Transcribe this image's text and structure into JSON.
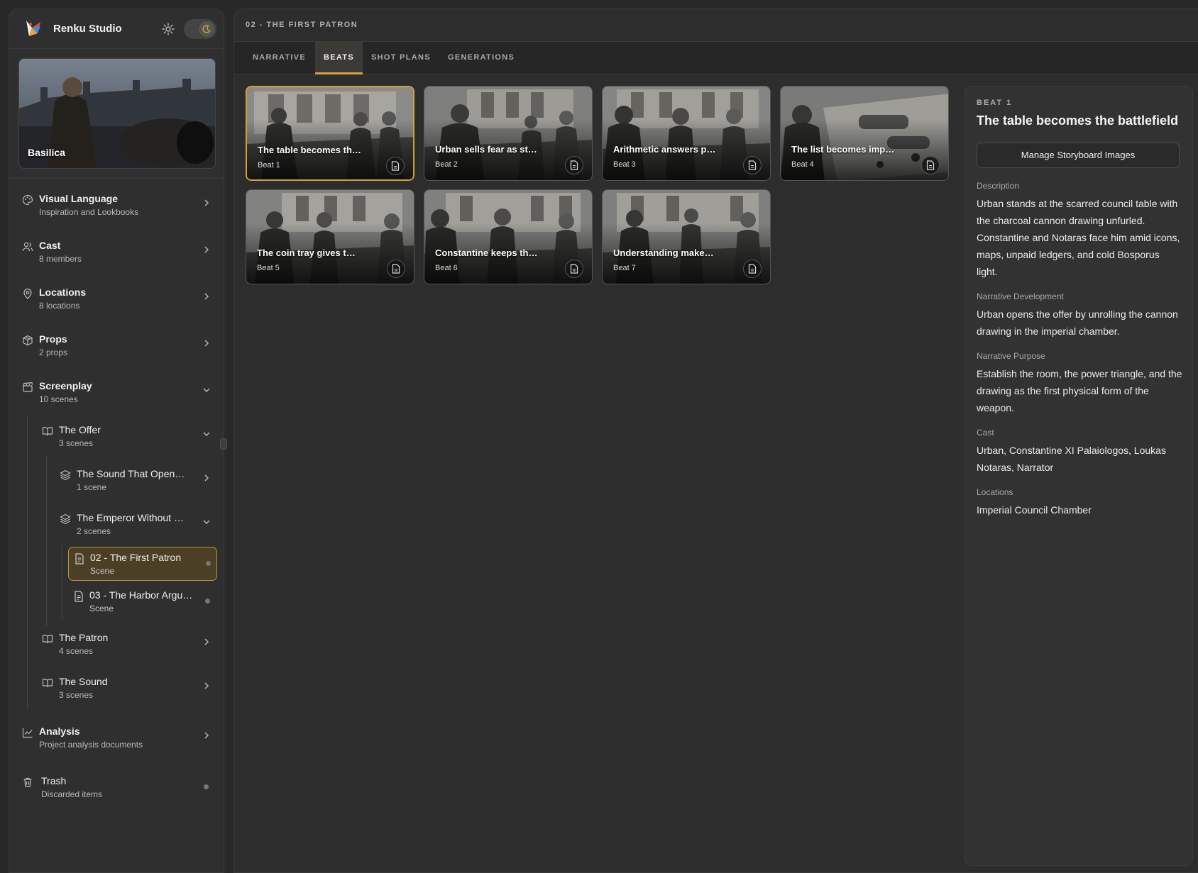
{
  "app": {
    "name": "Renku Studio"
  },
  "project": {
    "name": "Basilica"
  },
  "sidebar": {
    "items": [
      {
        "title": "Visual Language",
        "sub": "Inspiration and Lookbooks"
      },
      {
        "title": "Cast",
        "sub": "8 members"
      },
      {
        "title": "Locations",
        "sub": "8 locations"
      },
      {
        "title": "Props",
        "sub": "2 props"
      },
      {
        "title": "Screenplay",
        "sub": "10 scenes"
      },
      {
        "title": "Analysis",
        "sub": "Project analysis documents"
      },
      {
        "title": "Trash",
        "sub": "Discarded items"
      }
    ],
    "acts": [
      {
        "title": "The Offer",
        "sub": "3 scenes"
      },
      {
        "title": "The Patron",
        "sub": "4 scenes"
      },
      {
        "title": "The Sound",
        "sub": "3 scenes"
      }
    ],
    "sequences": [
      {
        "title": "The Sound That Open…",
        "sub": "1 scene"
      },
      {
        "title": "The Emperor Without …",
        "sub": "2 scenes"
      }
    ],
    "scenes": [
      {
        "title": "02 - The First Patron",
        "sub": "Scene"
      },
      {
        "title": "03 - The Harbor Argu…",
        "sub": "Scene"
      }
    ]
  },
  "main": {
    "breadcrumb": "02 - THE FIRST PATRON",
    "tabs": [
      "NARRATIVE",
      "BEATS",
      "SHOT PLANS",
      "GENERATIONS"
    ],
    "beats": [
      {
        "title": "The table becomes th…",
        "label": "Beat 1"
      },
      {
        "title": "Urban sells fear as st…",
        "label": "Beat 2"
      },
      {
        "title": "Arithmetic answers p…",
        "label": "Beat 3"
      },
      {
        "title": "The list becomes imp…",
        "label": "Beat 4"
      },
      {
        "title": "The coin tray gives t…",
        "label": "Beat 5"
      },
      {
        "title": "Constantine keeps th…",
        "label": "Beat 6"
      },
      {
        "title": "Understanding make…",
        "label": "Beat 7"
      }
    ]
  },
  "detail": {
    "eyebrow": "BEAT 1",
    "title": "The table becomes the battlefield",
    "button": "Manage Storyboard Images",
    "description_label": "Description",
    "description": "Urban stands at the scarred council table with the charcoal cannon drawing unfurled. Constantine and Notaras face him amid icons, maps, unpaid ledgers, and cold Bosporus light.",
    "development_label": "Narrative Development",
    "development": "Urban opens the offer by unrolling the cannon drawing in the imperial chamber.",
    "purpose_label": "Narrative Purpose",
    "purpose": "Establish the room, the power triangle, and the drawing as the first physical form of the weapon.",
    "cast_label": "Cast",
    "cast": "Urban, Constantine XI Palaiologos, Loukas Notaras, Narrator",
    "locations_label": "Locations",
    "locations": "Imperial Council Chamber"
  },
  "colors": {
    "accent": "#d4a03a",
    "active_bg": "#4b3f26"
  }
}
